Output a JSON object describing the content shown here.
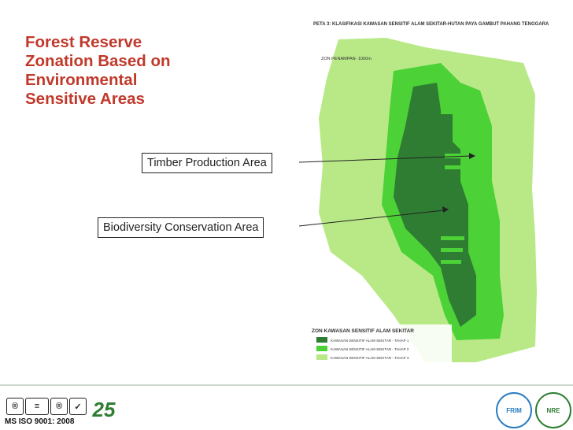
{
  "title_lines": [
    "Forest Reserve",
    "Zonation Based on",
    "Environmental",
    "Sensitive Areas"
  ],
  "labels": {
    "timber": "Timber Production Area",
    "biodiversity": "Biodiversity Conservation Area"
  },
  "map": {
    "heading": "PETA 3: KLASIFIKASI KAWASAN SENSITIF ALAM SEKITAR-HUTAN PAYA GAMBUT PAHANG TENGGARA",
    "buffer_label": "ZON PENAMPAN- 1000m",
    "legend_title": "ZON KAWASAN SENSITIF ALAM SEKITAR",
    "legend_items": [
      {
        "text": "KAWASAN SENSITIF ALAM SEKITAR - TAHAP 1",
        "color": "#2e7d32"
      },
      {
        "text": "KAWASAN SENSITIF ALAM SEKITAR - TAHAP 2",
        "color": "#4cd137"
      },
      {
        "text": "KAWASAN SENSITIF ALAM SEKITAR - TAHAP 3",
        "color": "#b8e986"
      }
    ]
  },
  "footer": {
    "iso": "MS ISO 9001: 2008",
    "anniversary": "25",
    "frim": "FRIM",
    "nre": "NRE"
  },
  "colors": {
    "title": "#c0392b",
    "tahap1": "#2e7d32",
    "tahap2": "#4cd137",
    "tahap3": "#b8e986"
  }
}
